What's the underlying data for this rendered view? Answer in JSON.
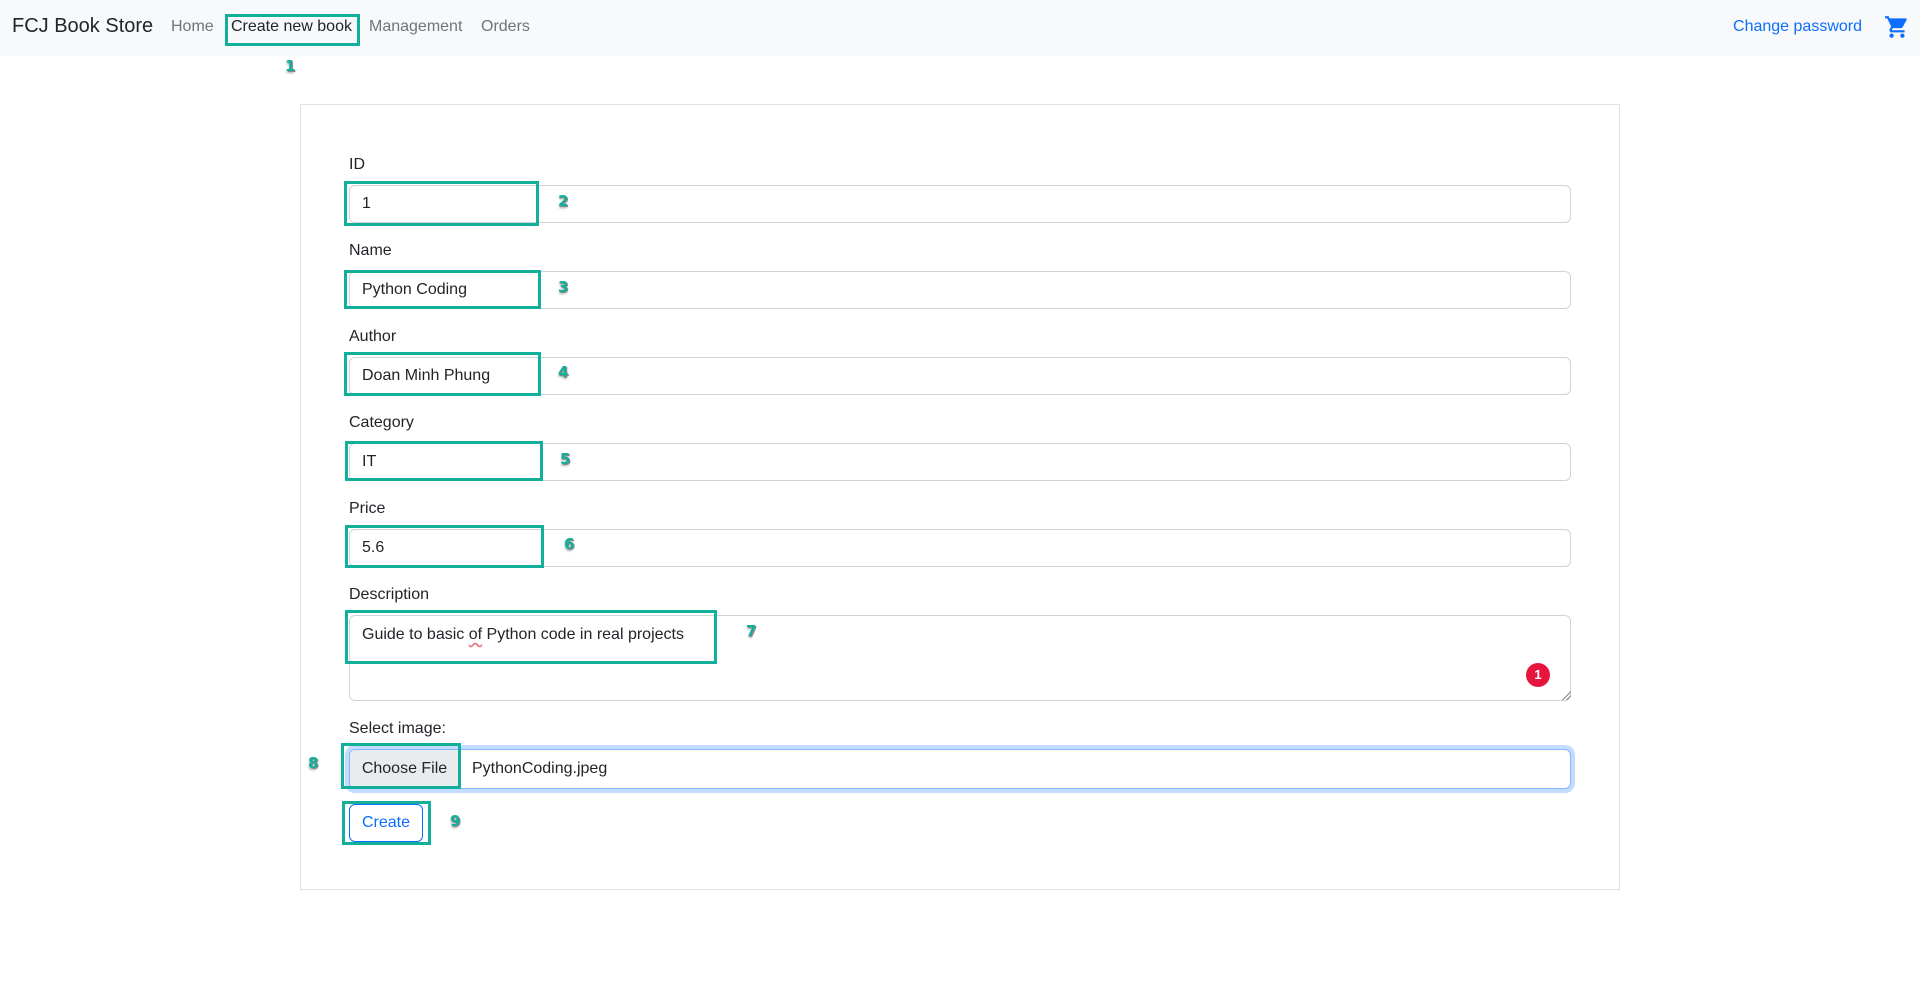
{
  "navbar": {
    "brand": "FCJ Book Store",
    "links": [
      "Home",
      "Create new book",
      "Management",
      "Orders"
    ],
    "active": "Create new book",
    "right_link": "Change password",
    "cart_icon": "shopping-cart-icon",
    "accent_color": "#0d6efd"
  },
  "form": {
    "fields": [
      {
        "label": "ID",
        "value": "1"
      },
      {
        "label": "Name",
        "value": "Python Coding"
      },
      {
        "label": "Author",
        "value": "Doan Minh Phung"
      },
      {
        "label": "Category",
        "value": "IT"
      },
      {
        "label": "Price",
        "value": "5.6"
      }
    ],
    "description": {
      "label": "Description",
      "value_before": "Guide to basic ",
      "value_misspelled": "of",
      "value_after": " Python code in real projects",
      "grammar_badge_count": "1"
    },
    "image": {
      "label": "Select image:",
      "button": "Choose File",
      "file_name": "PythonCoding.jpeg"
    },
    "submit_label": "Create"
  },
  "annotations": {
    "color": "#12b09a",
    "numbers": [
      "1",
      "2",
      "3",
      "4",
      "5",
      "6",
      "7",
      "8",
      "9"
    ]
  }
}
